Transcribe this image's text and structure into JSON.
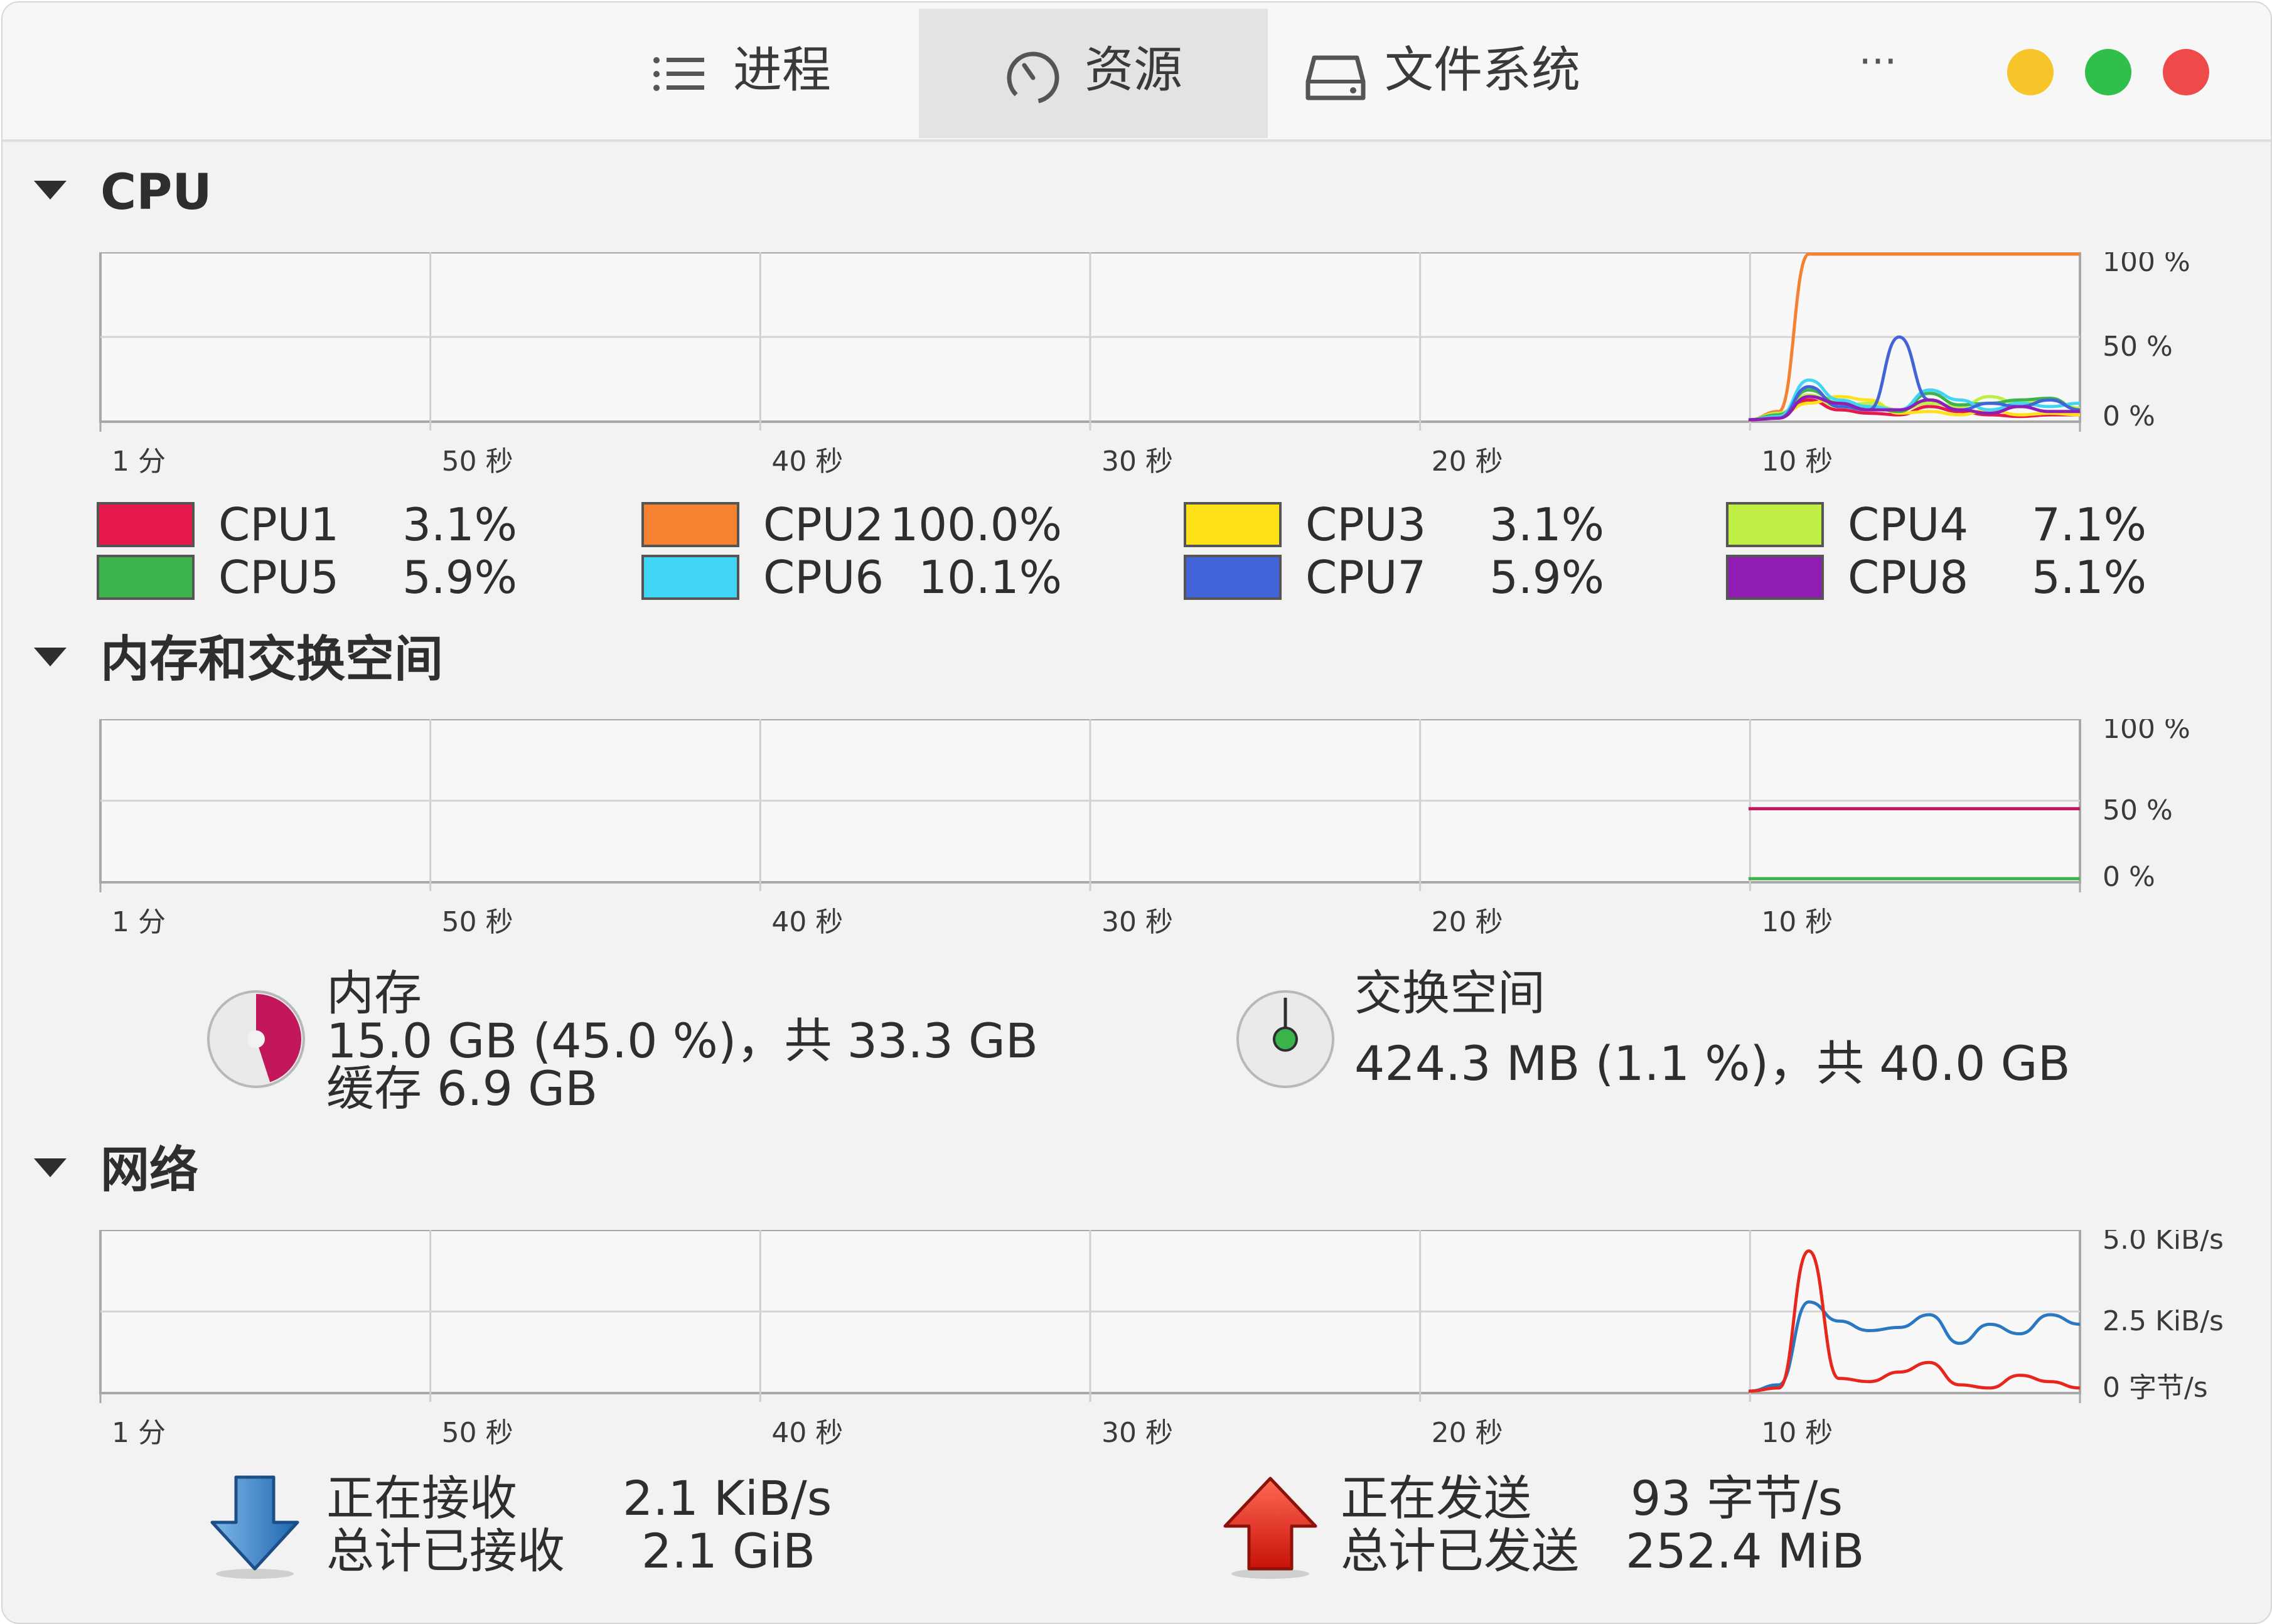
{
  "tabs": [
    {
      "label": "进程",
      "icon": "list-icon"
    },
    {
      "label": "资源",
      "icon": "gauge-icon",
      "active": true
    },
    {
      "label": "文件系统",
      "icon": "drive-icon"
    }
  ],
  "menu_label": "···",
  "window_controls": {
    "minimize": "#f7c52a",
    "maximize": "#2fbf4a",
    "close": "#ef4a4a"
  },
  "sections": {
    "cpu": {
      "title": "CPU"
    },
    "memory": {
      "title": "内存和交换空间"
    },
    "network": {
      "title": "网络"
    }
  },
  "x_ticks": [
    "1 分",
    "50 秒",
    "40 秒",
    "30 秒",
    "20 秒",
    "10 秒"
  ],
  "cpu_legend": [
    {
      "name": "CPU1",
      "value": "3.1%",
      "color": "#e6194b"
    },
    {
      "name": "CPU2",
      "value": "100.0%",
      "color": "#f58231"
    },
    {
      "name": "CPU3",
      "value": "3.1%",
      "color": "#ffe119"
    },
    {
      "name": "CPU4",
      "value": "7.1%",
      "color": "#bfef45"
    },
    {
      "name": "CPU5",
      "value": "5.9%",
      "color": "#3cb44b"
    },
    {
      "name": "CPU6",
      "value": "10.1%",
      "color": "#42d4f4"
    },
    {
      "name": "CPU7",
      "value": "5.9%",
      "color": "#4363d8"
    },
    {
      "name": "CPU8",
      "value": "5.1%",
      "color": "#911eb4"
    }
  ],
  "memory": {
    "label": "内存",
    "usage": "15.0 GB (45.0 %)，共 33.3 GB",
    "cache": "缓存 6.9 GB",
    "percent": 45.0,
    "color": "#c2185b"
  },
  "swap": {
    "label": "交换空间",
    "usage": "424.3 MB (1.1 %)，共 40.0 GB",
    "percent": 1.1,
    "color": "#3cb44b"
  },
  "network": {
    "receiving_label": "正在接收",
    "receiving_value": "2.1 KiB/s",
    "total_received_label": "总计已接收",
    "total_received_value": "2.1 GiB",
    "sending_label": "正在发送",
    "sending_value": "93 字节/s",
    "total_sent_label": "总计已发送",
    "total_sent_value": "252.4 MiB"
  },
  "chart_data": [
    {
      "type": "line",
      "title": "CPU",
      "x_tick_labels": [
        "1 分",
        "50 秒",
        "40 秒",
        "30 秒",
        "20 秒",
        "10 秒"
      ],
      "y_tick_labels": [
        "100 %",
        "50 %",
        "0 %"
      ],
      "ylim": [
        0,
        100
      ],
      "x": [
        -11,
        -10,
        -9,
        -8,
        -7,
        -6,
        -5,
        -4,
        -3,
        -2,
        -1,
        0
      ],
      "series": [
        {
          "name": "CPU1",
          "color": "#e6194b",
          "values": [
            0,
            2,
            12,
            6,
            4,
            3,
            8,
            5,
            3,
            2,
            3,
            3
          ]
        },
        {
          "name": "CPU2",
          "color": "#f58231",
          "values": [
            0,
            5,
            100,
            100,
            100,
            100,
            100,
            100,
            100,
            100,
            100,
            100
          ]
        },
        {
          "name": "CPU3",
          "color": "#ffe119",
          "values": [
            0,
            3,
            10,
            14,
            12,
            4,
            5,
            3,
            6,
            3,
            4,
            3
          ]
        },
        {
          "name": "CPU4",
          "color": "#bfef45",
          "values": [
            0,
            4,
            15,
            8,
            10,
            6,
            10,
            8,
            14,
            10,
            12,
            7
          ]
        },
        {
          "name": "CPU5",
          "color": "#3cb44b",
          "values": [
            0,
            3,
            18,
            10,
            8,
            5,
            16,
            9,
            10,
            12,
            13,
            6
          ]
        },
        {
          "name": "CPU6",
          "color": "#42d4f4",
          "values": [
            0,
            2,
            24,
            12,
            8,
            6,
            18,
            12,
            6,
            10,
            8,
            10
          ]
        },
        {
          "name": "CPU7",
          "color": "#4363d8",
          "values": [
            0,
            1,
            20,
            8,
            6,
            50,
            12,
            6,
            10,
            8,
            12,
            6
          ]
        },
        {
          "name": "CPU8",
          "color": "#911eb4",
          "values": [
            0,
            1,
            14,
            10,
            6,
            6,
            12,
            6,
            4,
            8,
            5,
            5
          ]
        }
      ]
    },
    {
      "type": "line",
      "title": "内存和交换空间",
      "x_tick_labels": [
        "1 分",
        "50 秒",
        "40 秒",
        "30 秒",
        "20 秒",
        "10 秒"
      ],
      "y_tick_labels": [
        "100 %",
        "50 %",
        "0 %"
      ],
      "ylim": [
        0,
        100
      ],
      "x": [
        -11,
        0
      ],
      "series": [
        {
          "name": "内存",
          "color": "#c2185b",
          "values": [
            45.0,
            45.0
          ]
        },
        {
          "name": "交换空间",
          "color": "#3cb44b",
          "values": [
            1.1,
            1.1
          ]
        }
      ]
    },
    {
      "type": "line",
      "title": "网络",
      "x_tick_labels": [
        "1 分",
        "50 秒",
        "40 秒",
        "30 秒",
        "20 秒",
        "10 秒"
      ],
      "y_tick_labels": [
        "5.0 KiB/s",
        "2.5 KiB/s",
        "0 字节/s"
      ],
      "ylim": [
        0,
        5.0
      ],
      "x": [
        -11,
        -10,
        -9,
        -8,
        -7,
        -6,
        -5,
        -4,
        -3,
        -2,
        -1,
        0
      ],
      "series": [
        {
          "name": "正在接收",
          "color": "#2a77c2",
          "values": [
            0,
            0.2,
            2.8,
            2.2,
            1.9,
            2.0,
            2.4,
            1.5,
            2.1,
            1.8,
            2.4,
            2.1
          ]
        },
        {
          "name": "正在发送",
          "color": "#e8271c",
          "values": [
            0,
            0.1,
            4.4,
            0.4,
            0.3,
            0.6,
            0.9,
            0.2,
            0.1,
            0.5,
            0.3,
            0.1
          ]
        }
      ]
    }
  ]
}
